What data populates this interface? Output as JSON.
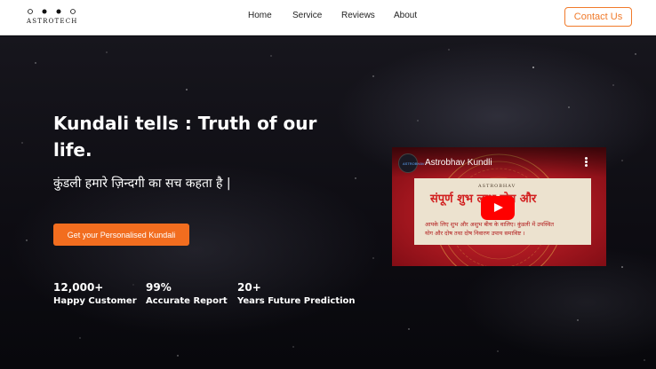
{
  "brand": {
    "name": "ASTROTECH"
  },
  "nav": {
    "links": [
      {
        "label": "Home"
      },
      {
        "label": "Service"
      },
      {
        "label": "Reviews"
      },
      {
        "label": "About"
      }
    ],
    "contact_label": "Contact Us"
  },
  "hero": {
    "headline_line1": "Kundali tells : Truth of our",
    "headline_line2": "life.",
    "subheadline": "कुंडली हमारे ज़िन्दगी का सच कहता है |",
    "cta_label": "Get your Personalised Kundali",
    "stats": [
      {
        "value": "12,000+",
        "label": "Happy Customer"
      },
      {
        "value": "99%",
        "label": "Accurate Report"
      },
      {
        "value": "20+",
        "label": "Years Future Prediction"
      }
    ]
  },
  "video": {
    "title": "Astrobhav Kundli",
    "channel_avatar_text": "ASTROBHAV",
    "card_logo": "ASTROBHAV",
    "card_heading": "संपूर्ण शुभ  लाभ दोष और",
    "card_line1": "आपके लिए शुभ और अशुभ बीच के वालिए। कुंडली में उपस्थित",
    "card_line2": "योग और दोष तथा दोष निवारण उपाय समाविष्ट ।"
  },
  "colors": {
    "accent": "#f26d1f",
    "nav_background": "#ffffff",
    "hero_background": "#0d0c12",
    "video_background": "#a3121d",
    "youtube_red": "#ff0000"
  },
  "icons": {
    "logo": "crescent-moon-phases-logo",
    "play": "youtube-play-icon",
    "menu": "vertical-dots-menu-icon"
  }
}
